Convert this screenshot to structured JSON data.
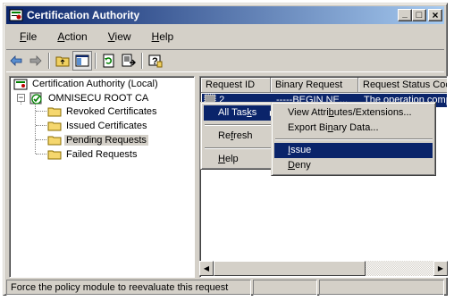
{
  "window": {
    "title": "Certification Authority"
  },
  "caption": {
    "minimize": "_",
    "maximize": "□",
    "close": "×"
  },
  "menu": [
    {
      "pre": "",
      "key": "F",
      "post": "ile"
    },
    {
      "pre": "",
      "key": "A",
      "post": "ction"
    },
    {
      "pre": "",
      "key": "V",
      "post": "iew"
    },
    {
      "pre": "",
      "key": "H",
      "post": "elp"
    }
  ],
  "toolbar": {
    "icons": [
      "back-arrow-icon",
      "forward-arrow-icon",
      "up-folder-icon",
      "show-hide-tree-icon",
      "refresh-icon",
      "export-list-icon",
      "help-icon"
    ]
  },
  "tree": {
    "root": "Certification Authority (Local)",
    "ca": "OMNISECU ROOT CA",
    "items": [
      "Revoked Certificates",
      "Issued Certificates",
      "Pending Requests",
      "Failed Requests"
    ],
    "selected": "Pending Requests"
  },
  "list": {
    "columns": [
      "Request ID",
      "Binary Request",
      "Request Status Coc"
    ],
    "rows": [
      {
        "id": "2",
        "binary": "-----BEGIN NE...",
        "status": "The operation comp"
      }
    ]
  },
  "context_menu": {
    "all_tasks": {
      "pre": "All Tas",
      "key": "k",
      "post": "s"
    },
    "refresh": {
      "pre": "Re",
      "key": "f",
      "post": "resh"
    },
    "help": {
      "pre": "",
      "key": "H",
      "post": "elp"
    }
  },
  "submenu": {
    "view_attr": {
      "pre": "View Attri",
      "key": "b",
      "post": "utes/Extensions..."
    },
    "export_binary": {
      "pre": "Export Bi",
      "key": "n",
      "post": "ary Data..."
    },
    "issue": {
      "pre": "",
      "key": "I",
      "post": "ssue"
    },
    "deny": {
      "pre": "",
      "key": "D",
      "post": "eny"
    }
  },
  "statusbar": {
    "text": "Force the policy module to reevaluate this request"
  },
  "colors": {
    "selection": "#0a246a",
    "face": "#d4d0c8",
    "title_gradient_end": "#a6caf0"
  }
}
